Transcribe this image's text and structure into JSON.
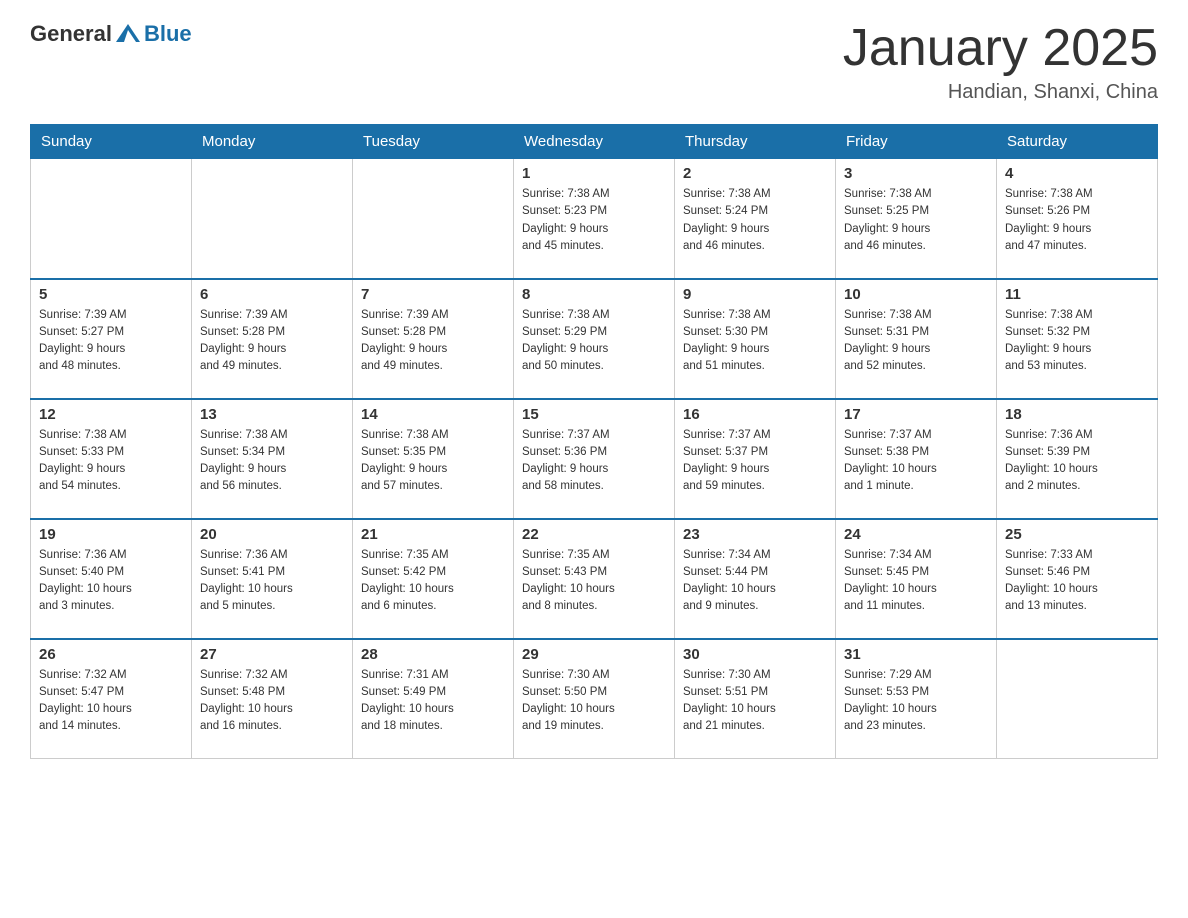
{
  "header": {
    "logo_general": "General",
    "logo_blue": "Blue",
    "month_year": "January 2025",
    "location": "Handian, Shanxi, China"
  },
  "weekdays": [
    "Sunday",
    "Monday",
    "Tuesday",
    "Wednesday",
    "Thursday",
    "Friday",
    "Saturday"
  ],
  "weeks": [
    [
      {
        "day": "",
        "info": ""
      },
      {
        "day": "",
        "info": ""
      },
      {
        "day": "",
        "info": ""
      },
      {
        "day": "1",
        "info": "Sunrise: 7:38 AM\nSunset: 5:23 PM\nDaylight: 9 hours\nand 45 minutes."
      },
      {
        "day": "2",
        "info": "Sunrise: 7:38 AM\nSunset: 5:24 PM\nDaylight: 9 hours\nand 46 minutes."
      },
      {
        "day": "3",
        "info": "Sunrise: 7:38 AM\nSunset: 5:25 PM\nDaylight: 9 hours\nand 46 minutes."
      },
      {
        "day": "4",
        "info": "Sunrise: 7:38 AM\nSunset: 5:26 PM\nDaylight: 9 hours\nand 47 minutes."
      }
    ],
    [
      {
        "day": "5",
        "info": "Sunrise: 7:39 AM\nSunset: 5:27 PM\nDaylight: 9 hours\nand 48 minutes."
      },
      {
        "day": "6",
        "info": "Sunrise: 7:39 AM\nSunset: 5:28 PM\nDaylight: 9 hours\nand 49 minutes."
      },
      {
        "day": "7",
        "info": "Sunrise: 7:39 AM\nSunset: 5:28 PM\nDaylight: 9 hours\nand 49 minutes."
      },
      {
        "day": "8",
        "info": "Sunrise: 7:38 AM\nSunset: 5:29 PM\nDaylight: 9 hours\nand 50 minutes."
      },
      {
        "day": "9",
        "info": "Sunrise: 7:38 AM\nSunset: 5:30 PM\nDaylight: 9 hours\nand 51 minutes."
      },
      {
        "day": "10",
        "info": "Sunrise: 7:38 AM\nSunset: 5:31 PM\nDaylight: 9 hours\nand 52 minutes."
      },
      {
        "day": "11",
        "info": "Sunrise: 7:38 AM\nSunset: 5:32 PM\nDaylight: 9 hours\nand 53 minutes."
      }
    ],
    [
      {
        "day": "12",
        "info": "Sunrise: 7:38 AM\nSunset: 5:33 PM\nDaylight: 9 hours\nand 54 minutes."
      },
      {
        "day": "13",
        "info": "Sunrise: 7:38 AM\nSunset: 5:34 PM\nDaylight: 9 hours\nand 56 minutes."
      },
      {
        "day": "14",
        "info": "Sunrise: 7:38 AM\nSunset: 5:35 PM\nDaylight: 9 hours\nand 57 minutes."
      },
      {
        "day": "15",
        "info": "Sunrise: 7:37 AM\nSunset: 5:36 PM\nDaylight: 9 hours\nand 58 minutes."
      },
      {
        "day": "16",
        "info": "Sunrise: 7:37 AM\nSunset: 5:37 PM\nDaylight: 9 hours\nand 59 minutes."
      },
      {
        "day": "17",
        "info": "Sunrise: 7:37 AM\nSunset: 5:38 PM\nDaylight: 10 hours\nand 1 minute."
      },
      {
        "day": "18",
        "info": "Sunrise: 7:36 AM\nSunset: 5:39 PM\nDaylight: 10 hours\nand 2 minutes."
      }
    ],
    [
      {
        "day": "19",
        "info": "Sunrise: 7:36 AM\nSunset: 5:40 PM\nDaylight: 10 hours\nand 3 minutes."
      },
      {
        "day": "20",
        "info": "Sunrise: 7:36 AM\nSunset: 5:41 PM\nDaylight: 10 hours\nand 5 minutes."
      },
      {
        "day": "21",
        "info": "Sunrise: 7:35 AM\nSunset: 5:42 PM\nDaylight: 10 hours\nand 6 minutes."
      },
      {
        "day": "22",
        "info": "Sunrise: 7:35 AM\nSunset: 5:43 PM\nDaylight: 10 hours\nand 8 minutes."
      },
      {
        "day": "23",
        "info": "Sunrise: 7:34 AM\nSunset: 5:44 PM\nDaylight: 10 hours\nand 9 minutes."
      },
      {
        "day": "24",
        "info": "Sunrise: 7:34 AM\nSunset: 5:45 PM\nDaylight: 10 hours\nand 11 minutes."
      },
      {
        "day": "25",
        "info": "Sunrise: 7:33 AM\nSunset: 5:46 PM\nDaylight: 10 hours\nand 13 minutes."
      }
    ],
    [
      {
        "day": "26",
        "info": "Sunrise: 7:32 AM\nSunset: 5:47 PM\nDaylight: 10 hours\nand 14 minutes."
      },
      {
        "day": "27",
        "info": "Sunrise: 7:32 AM\nSunset: 5:48 PM\nDaylight: 10 hours\nand 16 minutes."
      },
      {
        "day": "28",
        "info": "Sunrise: 7:31 AM\nSunset: 5:49 PM\nDaylight: 10 hours\nand 18 minutes."
      },
      {
        "day": "29",
        "info": "Sunrise: 7:30 AM\nSunset: 5:50 PM\nDaylight: 10 hours\nand 19 minutes."
      },
      {
        "day": "30",
        "info": "Sunrise: 7:30 AM\nSunset: 5:51 PM\nDaylight: 10 hours\nand 21 minutes."
      },
      {
        "day": "31",
        "info": "Sunrise: 7:29 AM\nSunset: 5:53 PM\nDaylight: 10 hours\nand 23 minutes."
      },
      {
        "day": "",
        "info": ""
      }
    ]
  ]
}
